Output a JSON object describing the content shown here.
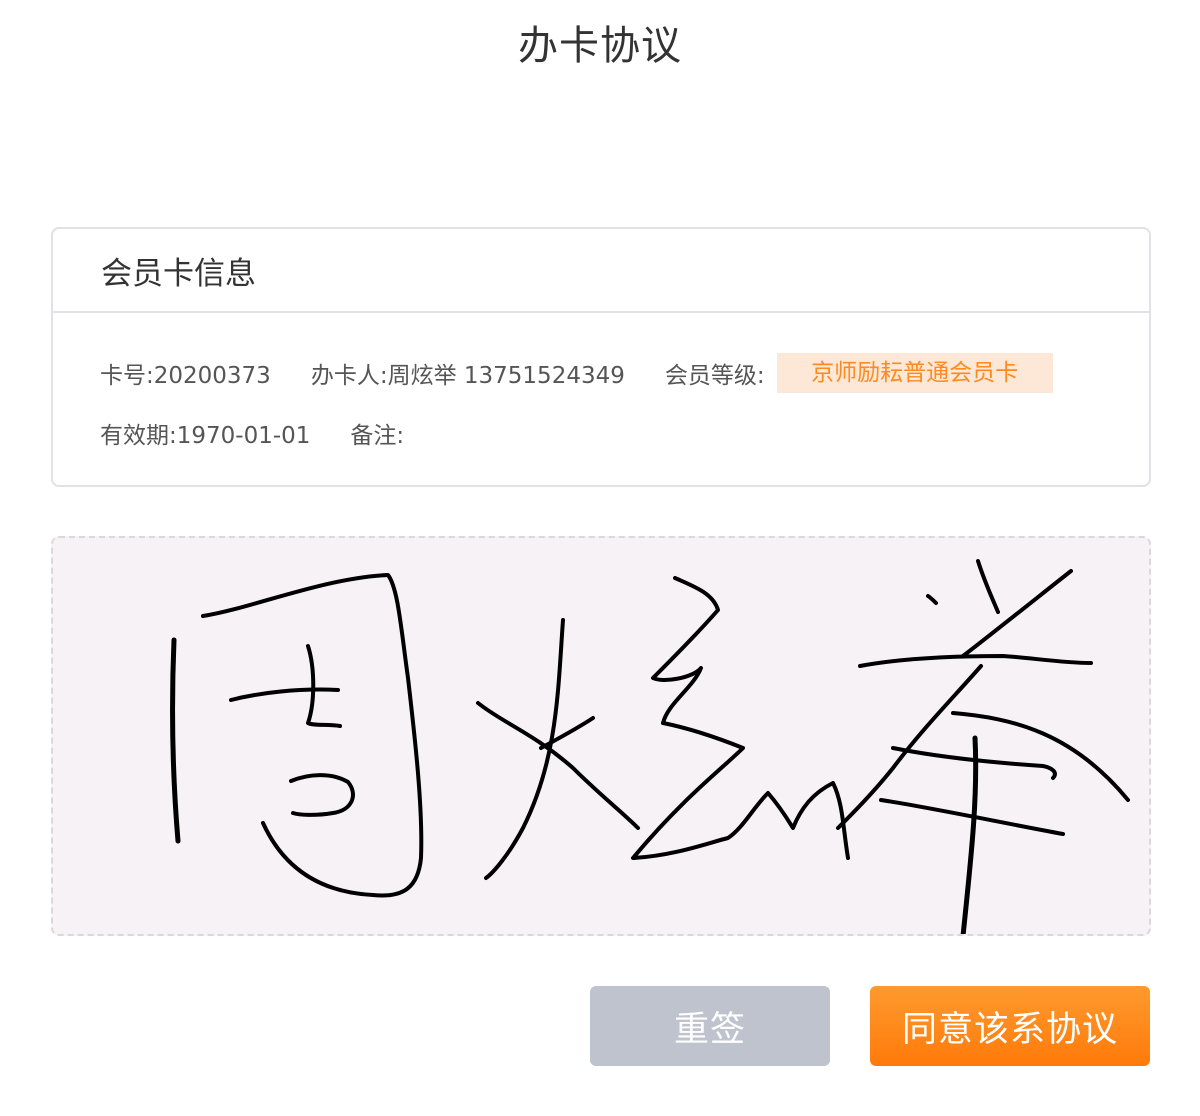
{
  "page": {
    "title": "办卡协议"
  },
  "card": {
    "title": "会员卡信息",
    "card_no": "卡号:20200373",
    "holder": "办卡人:周炫举 13751524349",
    "level_label": "会员等级:",
    "level_value": "京师励耘普通会员卡",
    "validity": "有效期:1970-01-01",
    "remark": "备注:"
  },
  "signature": {
    "handwritten_text": "周炫举",
    "stroke_color": "#000000"
  },
  "buttons": {
    "reset_label": "重签",
    "agree_label": "同意该系协议"
  },
  "colors": {
    "accent": "#ff8a1f",
    "badge_bg": "#fde7d6",
    "reset_bg": "#bec3cd",
    "signature_bg": "#f6f2f5"
  }
}
